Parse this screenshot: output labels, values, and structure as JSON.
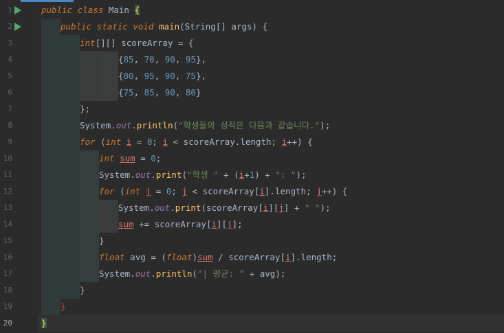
{
  "editor": {
    "accent_color": "#4a88c7",
    "gutter": {
      "line_numbers": [
        "1",
        "2",
        "3",
        "4",
        "5",
        "6",
        "7",
        "8",
        "9",
        "10",
        "11",
        "12",
        "13",
        "14",
        "15",
        "16",
        "17",
        "18",
        "19",
        "20"
      ],
      "run_icons": [
        "run-class-icon",
        "run-main-icon"
      ]
    },
    "lines": [
      [
        [
          "kw",
          "public"
        ],
        [
          "pl",
          " "
        ],
        [
          "kw",
          "class"
        ],
        [
          "pl",
          " "
        ],
        [
          "cls",
          "Main"
        ],
        [
          "pl",
          " "
        ],
        [
          "brace",
          "{"
        ]
      ],
      [
        [
          "kw",
          "public"
        ],
        [
          "pl",
          " "
        ],
        [
          "kw",
          "static"
        ],
        [
          "pl",
          " "
        ],
        [
          "kw",
          "void"
        ],
        [
          "pl",
          " "
        ],
        [
          "mth",
          "main"
        ],
        [
          "pl",
          "("
        ],
        [
          "cls",
          "String"
        ],
        [
          "pl",
          "[] "
        ],
        [
          "var",
          "args"
        ],
        [
          "pl",
          ") {"
        ]
      ],
      [
        [
          "kw",
          "int"
        ],
        [
          "pl",
          "[][] "
        ],
        [
          "var",
          "scoreArray"
        ],
        [
          "pl",
          " = {"
        ]
      ],
      [
        [
          "pl",
          "{"
        ],
        [
          "num",
          "85"
        ],
        [
          "pl",
          ", "
        ],
        [
          "num",
          "70"
        ],
        [
          "pl",
          ", "
        ],
        [
          "num",
          "90"
        ],
        [
          "pl",
          ", "
        ],
        [
          "num",
          "95"
        ],
        [
          "pl",
          "},"
        ]
      ],
      [
        [
          "pl",
          "{"
        ],
        [
          "num",
          "80"
        ],
        [
          "pl",
          ", "
        ],
        [
          "num",
          "95"
        ],
        [
          "pl",
          ", "
        ],
        [
          "num",
          "90"
        ],
        [
          "pl",
          ", "
        ],
        [
          "num",
          "75"
        ],
        [
          "pl",
          "},"
        ]
      ],
      [
        [
          "pl",
          "{"
        ],
        [
          "num",
          "75"
        ],
        [
          "pl",
          ", "
        ],
        [
          "num",
          "85"
        ],
        [
          "pl",
          ", "
        ],
        [
          "num",
          "90"
        ],
        [
          "pl",
          ", "
        ],
        [
          "num",
          "80"
        ],
        [
          "pl",
          "}"
        ]
      ],
      [
        [
          "pl",
          "};"
        ]
      ],
      [
        [
          "sys",
          "System"
        ],
        [
          "pl",
          "."
        ],
        [
          "fld",
          "out"
        ],
        [
          "pl",
          "."
        ],
        [
          "mth",
          "println"
        ],
        [
          "pl",
          "("
        ],
        [
          "str",
          "\"학생들의 성적은 다음과 같습니다.\""
        ],
        [
          "pl",
          ");"
        ]
      ],
      [
        [
          "kw",
          "for"
        ],
        [
          "pl",
          " ("
        ],
        [
          "kw",
          "int"
        ],
        [
          "pl",
          " "
        ],
        [
          "ulv",
          "i"
        ],
        [
          "pl",
          " = "
        ],
        [
          "num",
          "0"
        ],
        [
          "pl",
          "; "
        ],
        [
          "ulv",
          "i"
        ],
        [
          "pl",
          " < "
        ],
        [
          "var",
          "scoreArray"
        ],
        [
          "pl",
          "."
        ],
        [
          "var",
          "length"
        ],
        [
          "pl",
          "; "
        ],
        [
          "ulv",
          "i"
        ],
        [
          "pl",
          "++) {"
        ]
      ],
      [
        [
          "kw",
          "int"
        ],
        [
          "pl",
          " "
        ],
        [
          "ulv",
          "sum"
        ],
        [
          "pl",
          " = "
        ],
        [
          "num",
          "0"
        ],
        [
          "pl",
          ";"
        ]
      ],
      [
        [
          "sys",
          "System"
        ],
        [
          "pl",
          "."
        ],
        [
          "fld",
          "out"
        ],
        [
          "pl",
          "."
        ],
        [
          "mth",
          "print"
        ],
        [
          "pl",
          "("
        ],
        [
          "str",
          "\"학생 \""
        ],
        [
          "pl",
          " + ("
        ],
        [
          "ulv",
          "i"
        ],
        [
          "pl",
          "+"
        ],
        [
          "num",
          "1"
        ],
        [
          "pl",
          ") + "
        ],
        [
          "str",
          "\": \""
        ],
        [
          "pl",
          ");"
        ]
      ],
      [
        [
          "kw",
          "for"
        ],
        [
          "pl",
          " ("
        ],
        [
          "kw",
          "int"
        ],
        [
          "pl",
          " "
        ],
        [
          "ulv",
          "j"
        ],
        [
          "pl",
          " = "
        ],
        [
          "num",
          "0"
        ],
        [
          "pl",
          "; "
        ],
        [
          "ulv",
          "j"
        ],
        [
          "pl",
          " < "
        ],
        [
          "var",
          "scoreArray"
        ],
        [
          "pl",
          "["
        ],
        [
          "ulv",
          "i"
        ],
        [
          "pl",
          "]."
        ],
        [
          "var",
          "length"
        ],
        [
          "pl",
          "; "
        ],
        [
          "ulv",
          "j"
        ],
        [
          "pl",
          "++) {"
        ]
      ],
      [
        [
          "sys",
          "System"
        ],
        [
          "pl",
          "."
        ],
        [
          "fld",
          "out"
        ],
        [
          "pl",
          "."
        ],
        [
          "mth",
          "print"
        ],
        [
          "pl",
          "("
        ],
        [
          "var",
          "scoreArray"
        ],
        [
          "pl",
          "["
        ],
        [
          "ulv",
          "i"
        ],
        [
          "pl",
          "]["
        ],
        [
          "ulv",
          "j"
        ],
        [
          "pl",
          "] + "
        ],
        [
          "str",
          "\" \""
        ],
        [
          "pl",
          ");"
        ]
      ],
      [
        [
          "ulv",
          "sum"
        ],
        [
          "pl",
          " += "
        ],
        [
          "var",
          "scoreArray"
        ],
        [
          "pl",
          "["
        ],
        [
          "ulv",
          "i"
        ],
        [
          "pl",
          "]["
        ],
        [
          "ulv",
          "j"
        ],
        [
          "pl",
          "];"
        ]
      ],
      [
        [
          "pl",
          "}"
        ]
      ],
      [
        [
          "kw",
          "float"
        ],
        [
          "pl",
          " "
        ],
        [
          "var",
          "avg"
        ],
        [
          "pl",
          " = ("
        ],
        [
          "kw",
          "float"
        ],
        [
          "pl",
          ")"
        ],
        [
          "ulv",
          "sum"
        ],
        [
          "pl",
          " / "
        ],
        [
          "var",
          "scoreArray"
        ],
        [
          "pl",
          "["
        ],
        [
          "ulv",
          "i"
        ],
        [
          "pl",
          "]."
        ],
        [
          "var",
          "length"
        ],
        [
          "pl",
          ";"
        ]
      ],
      [
        [
          "sys",
          "System"
        ],
        [
          "pl",
          "."
        ],
        [
          "fld",
          "out"
        ],
        [
          "pl",
          "."
        ],
        [
          "mth",
          "println"
        ],
        [
          "pl",
          "("
        ],
        [
          "str",
          "\"| 평균: \""
        ],
        [
          "pl",
          " + "
        ],
        [
          "var",
          "avg"
        ],
        [
          "pl",
          ");"
        ]
      ],
      [
        [
          "pl",
          "}"
        ]
      ],
      [
        [
          "red",
          "}"
        ]
      ],
      [
        [
          "brace",
          "}"
        ]
      ]
    ]
  }
}
